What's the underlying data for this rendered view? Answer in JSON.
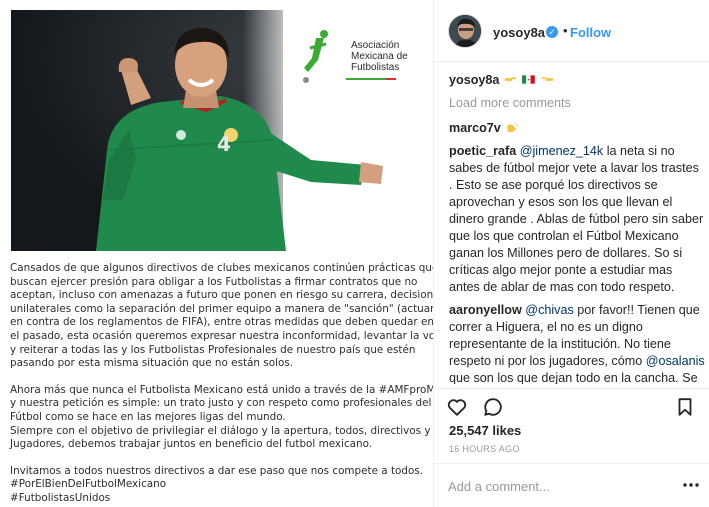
{
  "header": {
    "username": "yosoy8a",
    "separator": "•",
    "follow_label": "Follow"
  },
  "media": {
    "logo_lines": [
      "Asociación",
      "Mexicana de",
      "Futbolistas"
    ],
    "jersey_number": "4",
    "paragraphs": [
      [
        "Cansados de que algunos directivos de clubes mexicanos continúen prácticas que",
        "buscan ejercer presión para obligar a los Futbolistas a firmar contratos que no",
        "aceptan, incluso con amenazas a futuro que ponen en riesgo su carrera, decisiones",
        "unilaterales como la separación del primer equipo a manera de \"sanción\" (actuando",
        "en contra de los reglamentos de FIFA), entre otras medidas que deben quedar en",
        "el pasado, esta ocasión queremos expresar nuestra inconformidad, levantar la voz",
        "y reiterar a todas las y los Futbolistas Profesionales de nuestro país que estén",
        "pasando por esta misma situación que no están solos."
      ],
      [
        "Ahora más que nunca el Futbolista Mexicano está unido a través de la  #AMFproMX",
        "y nuestra petición es simple: un trato justo y con respeto como profesionales del",
        "Fútbol como se hace en las mejores ligas del mundo.",
        "Siempre con el objetivo de privilegiar el diálogo y la apertura, todos, directivos y",
        "Jugadores, debemos trabajar juntos en beneficio del futbol mexicano."
      ],
      [
        "Invitamos a todos nuestros directivos a dar ese paso que nos compete a todos.",
        "#PorElBienDelFutbolMexicano",
        "#FutbolistasUnidos"
      ]
    ]
  },
  "comments": {
    "caption_user": "yosoy8a",
    "load_more": "Load more comments",
    "items": [
      {
        "user": "marco7v",
        "text": ""
      },
      {
        "user": "poetic_rafa",
        "mention": "@jimenez_14k",
        "text": " la neta si no sabes de fútbol mejor vete a lavar los trastes . Esto se ase porqué los directivos se aprovechan y esos son los que llevan el dinero grande . Ablas de fútbol pero sin saber que los que controlan el Fútbol Mexicano ganan los Millones pero de dollares. So si críticas algo mejor ponte a estudiar mas antes de ablar de mas con todo respeto."
      },
      {
        "user": "aaronyellow",
        "mention": "@chivas",
        "text": " por favor!! Tienen que correr a Higuera, el no es un digno representante de la institución. No tiene respeto ni por los jugadores, cómo ",
        "mention2": "@osalanis",
        "text2": " que son los que dejan todo en la cancha. Se ve venir un peor torneo para"
      }
    ]
  },
  "footer": {
    "likes": "25,547 likes",
    "time_ago": "16 HOURS AGO",
    "add_comment_placeholder": "Add a comment...",
    "more_label": "•••"
  },
  "colors": {
    "accent": "#3897f0",
    "mention": "#003569",
    "muted": "#999999",
    "border": "#efefef",
    "jersey": "#1f8a4c"
  },
  "icons": [
    "heart-icon",
    "comment-icon",
    "bookmark-icon",
    "verified-badge-icon",
    "more-options-icon"
  ]
}
